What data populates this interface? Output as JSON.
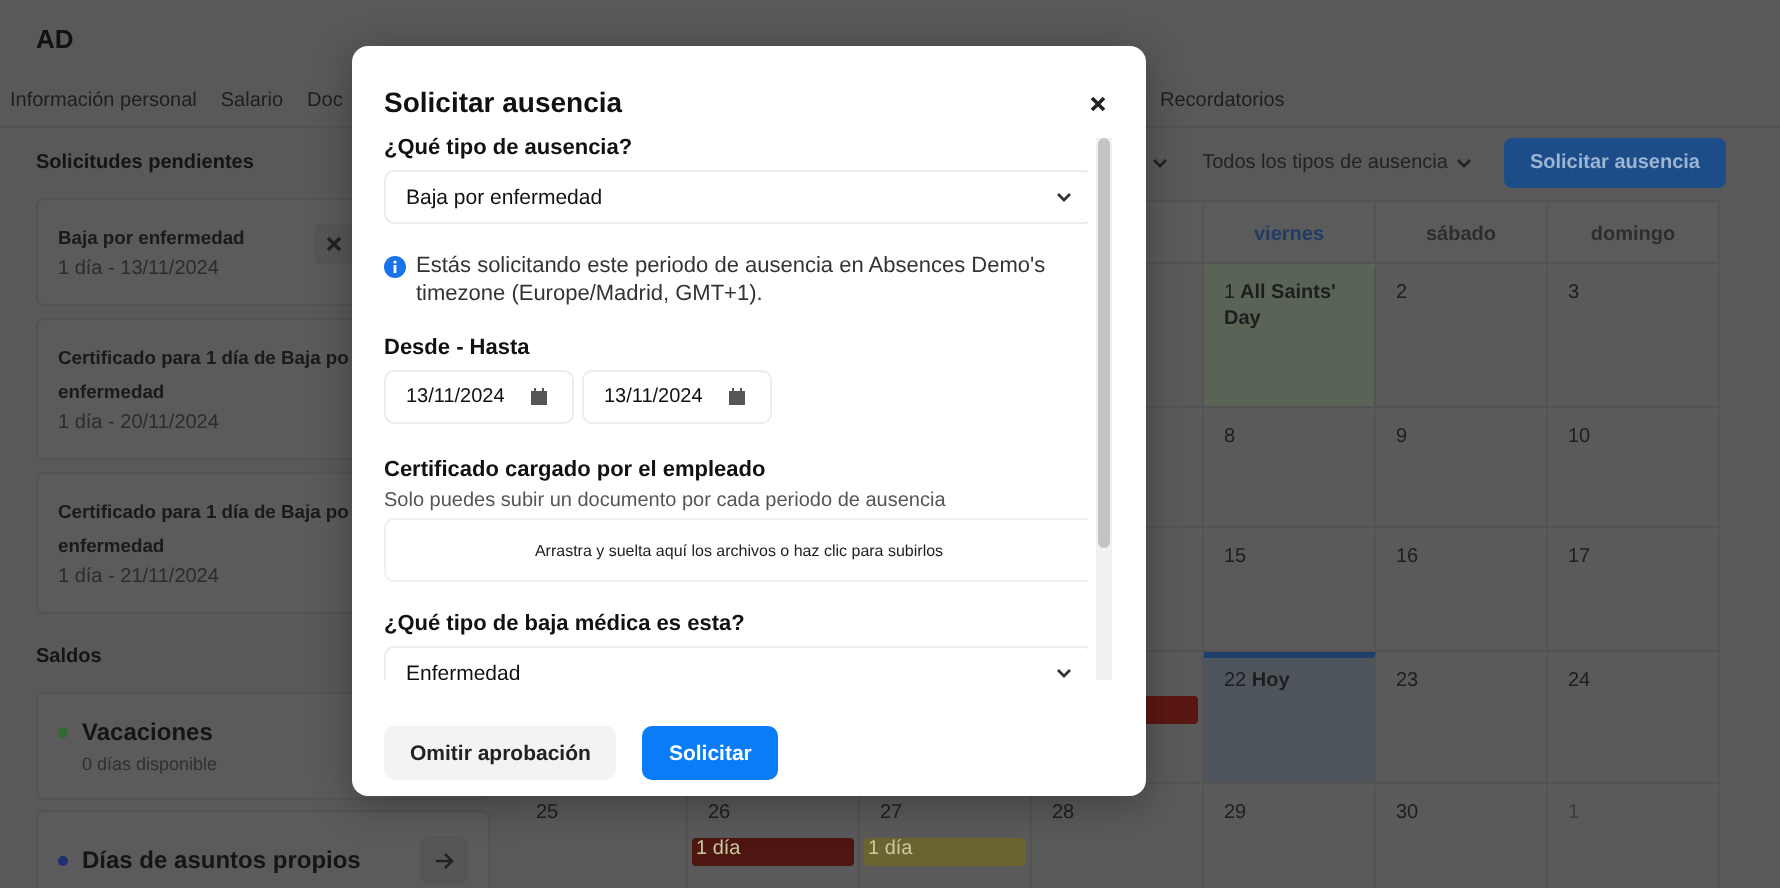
{
  "header": {
    "initials": "AD"
  },
  "tabs": [
    {
      "label": "Información personal"
    },
    {
      "label": "Salario"
    },
    {
      "label": "Doc"
    }
  ],
  "tabs_right": [
    {
      "label": "Recordatorios"
    }
  ],
  "pending": {
    "title": "Solicitudes pendientes",
    "requests": [
      {
        "title_lines": [
          "Baja por enfermedad"
        ],
        "detail": "1 día - 13/11/2024",
        "cancellable": true
      },
      {
        "title_lines": [
          "Certificado para 1 día de Baja po",
          "enfermedad"
        ],
        "detail": "1 día - 20/11/2024",
        "cancellable": false
      },
      {
        "title_lines": [
          "Certificado para 1 día de Baja po",
          "enfermedad"
        ],
        "detail": "1 día - 21/11/2024",
        "cancellable": false
      }
    ]
  },
  "balances": {
    "title": "Saldos",
    "items": [
      {
        "name": "Vacaciones",
        "color": "#2f6a2f",
        "note": "0 días disponible",
        "kind": "plain"
      },
      {
        "name": "Días de asuntos propios",
        "color": "#1f2f72",
        "kind": "link"
      }
    ]
  },
  "toolbar": {
    "filters": [
      {
        "kind": "collapsed"
      },
      {
        "kind": "labelled",
        "label": "Todos los tipos de ausencia"
      }
    ],
    "button": "Solicitar ausencia"
  },
  "calendar": {
    "weekdays": [
      {
        "label": "viernes",
        "today": true
      },
      {
        "label": "sábado",
        "today": false
      },
      {
        "label": "domingo",
        "today": false
      }
    ],
    "weeks": [
      [
        {
          "day": "1",
          "holiday": "All Saints' Day"
        },
        {
          "day": "2"
        },
        {
          "day": "3"
        }
      ],
      [
        {
          "day": "8"
        },
        {
          "day": "9"
        },
        {
          "day": "10"
        }
      ],
      [
        {
          "day": "15"
        },
        {
          "day": "16"
        },
        {
          "day": "17"
        }
      ],
      [
        {
          "events": [
            {
              "color": "#5a1712"
            }
          ]
        },
        {
          "day": "22",
          "today": true,
          "today_label": "Hoy"
        },
        {
          "day": "23"
        },
        {
          "day": "24"
        }
      ],
      [
        {
          "day": "25"
        },
        {
          "day": "26",
          "events": [
            {
              "label": "1 día",
              "color": "#4e1511"
            }
          ]
        },
        {
          "day": "27",
          "events": [
            {
              "label": "1 día",
              "color": "#6a6530"
            }
          ]
        },
        {
          "day": "28"
        },
        {
          "day": "29"
        },
        {
          "day": "30"
        },
        {
          "day": "1",
          "other_month": true
        }
      ]
    ]
  },
  "dialog": {
    "title": "Solicitar ausencia",
    "fields": [
      {
        "kind": "select",
        "label": "¿Qué tipo de ausencia?",
        "value": "Baja por enfermedad"
      },
      {
        "kind": "info",
        "text": "Estás solicitando este periodo de ausencia en Absences Demo's timezone (Europe/Madrid, GMT+1)."
      },
      {
        "kind": "daterange",
        "label": "Desde - Hasta",
        "from": "13/11/2024",
        "to": "13/11/2024"
      },
      {
        "kind": "upload",
        "label": "Certificado cargado por el empleado",
        "help": "Solo puedes subir un documento por cada periodo de ausencia",
        "dropzone": "Arrastra y suelta aquí los archivos o haz clic para subirlos"
      },
      {
        "kind": "select",
        "label": "¿Qué tipo de baja médica es esta?",
        "value": "Enfermedad"
      }
    ],
    "buttons": [
      {
        "label": "Omitir aprobación",
        "kind": "secondary"
      },
      {
        "label": "Solicitar",
        "kind": "primary"
      }
    ]
  }
}
